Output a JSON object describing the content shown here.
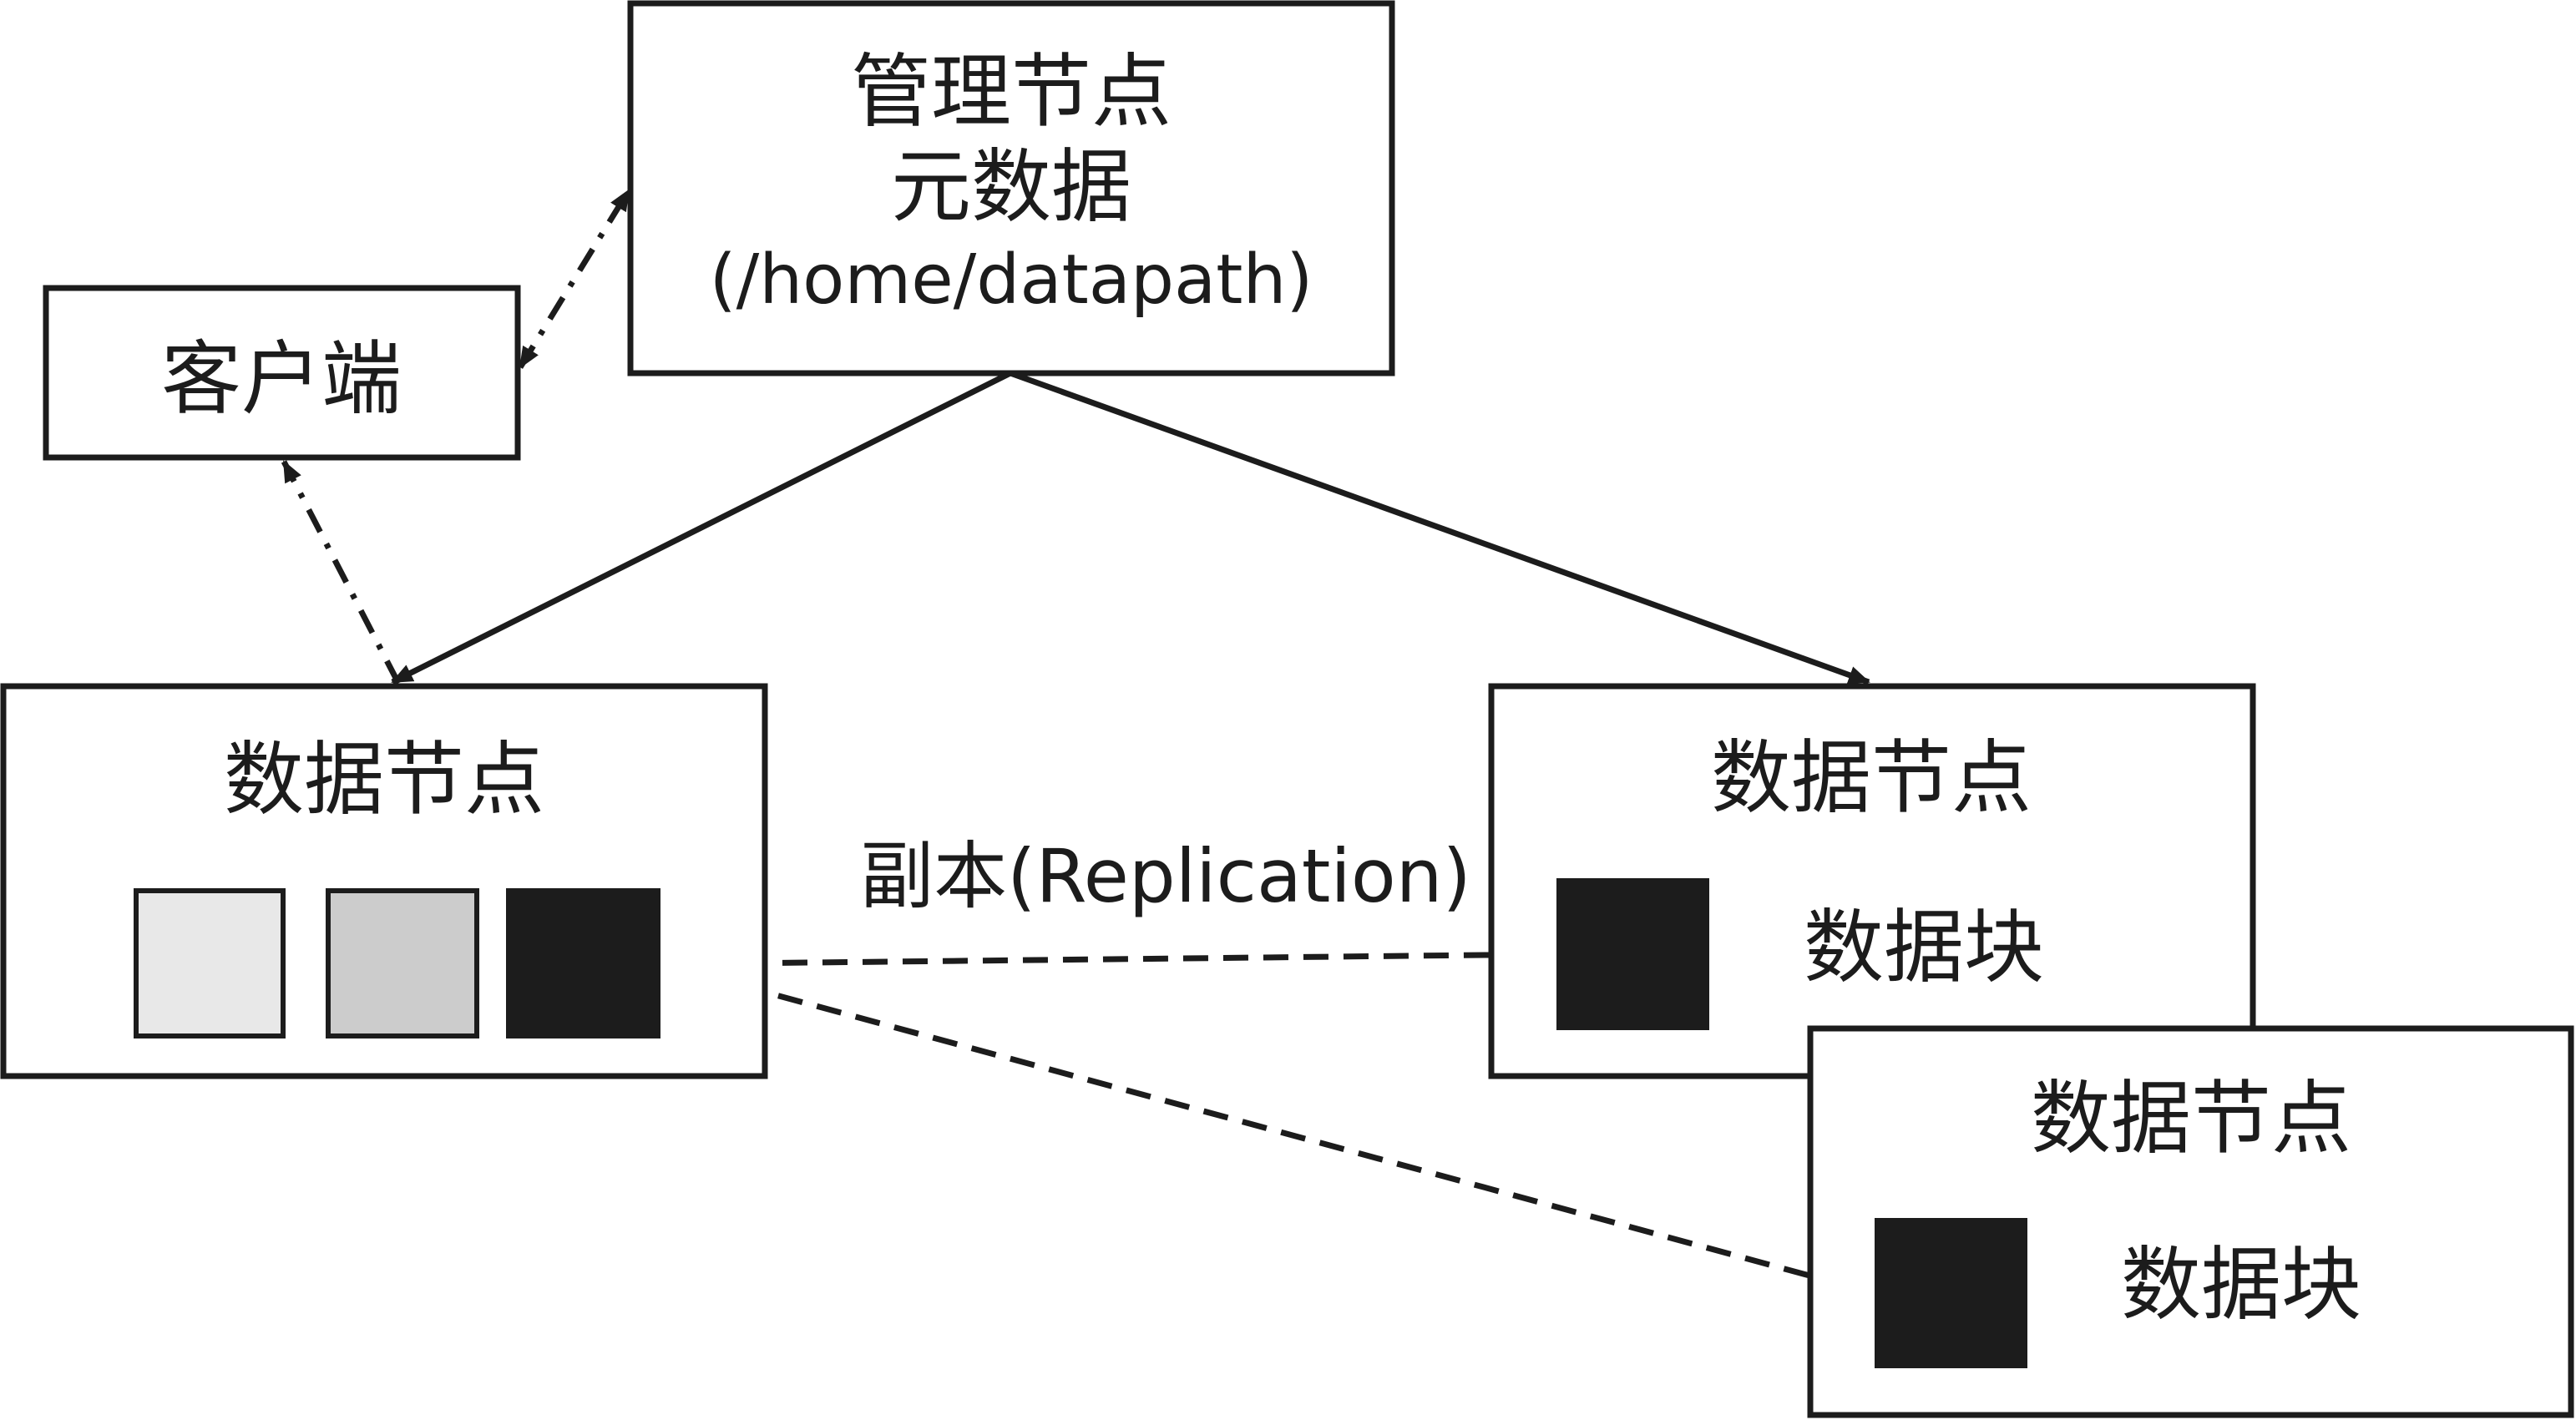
{
  "manager_node": {
    "title": "管理节点",
    "subtitle": "元数据",
    "path": "(/home/datapath)"
  },
  "client": {
    "label": "客户端"
  },
  "data_nodes": [
    {
      "title": "数据节点"
    },
    {
      "title": "数据节点",
      "block_label": "数据块"
    },
    {
      "title": "数据节点",
      "block_label": "数据块"
    }
  ],
  "replication_label": "副本(Replication)",
  "colors": {
    "stroke": "#1c1c1c",
    "block_light": "#e8e8e8",
    "block_medium": "#cccccc",
    "block_dark": "#1c1c1c",
    "background": "#ffffff"
  }
}
